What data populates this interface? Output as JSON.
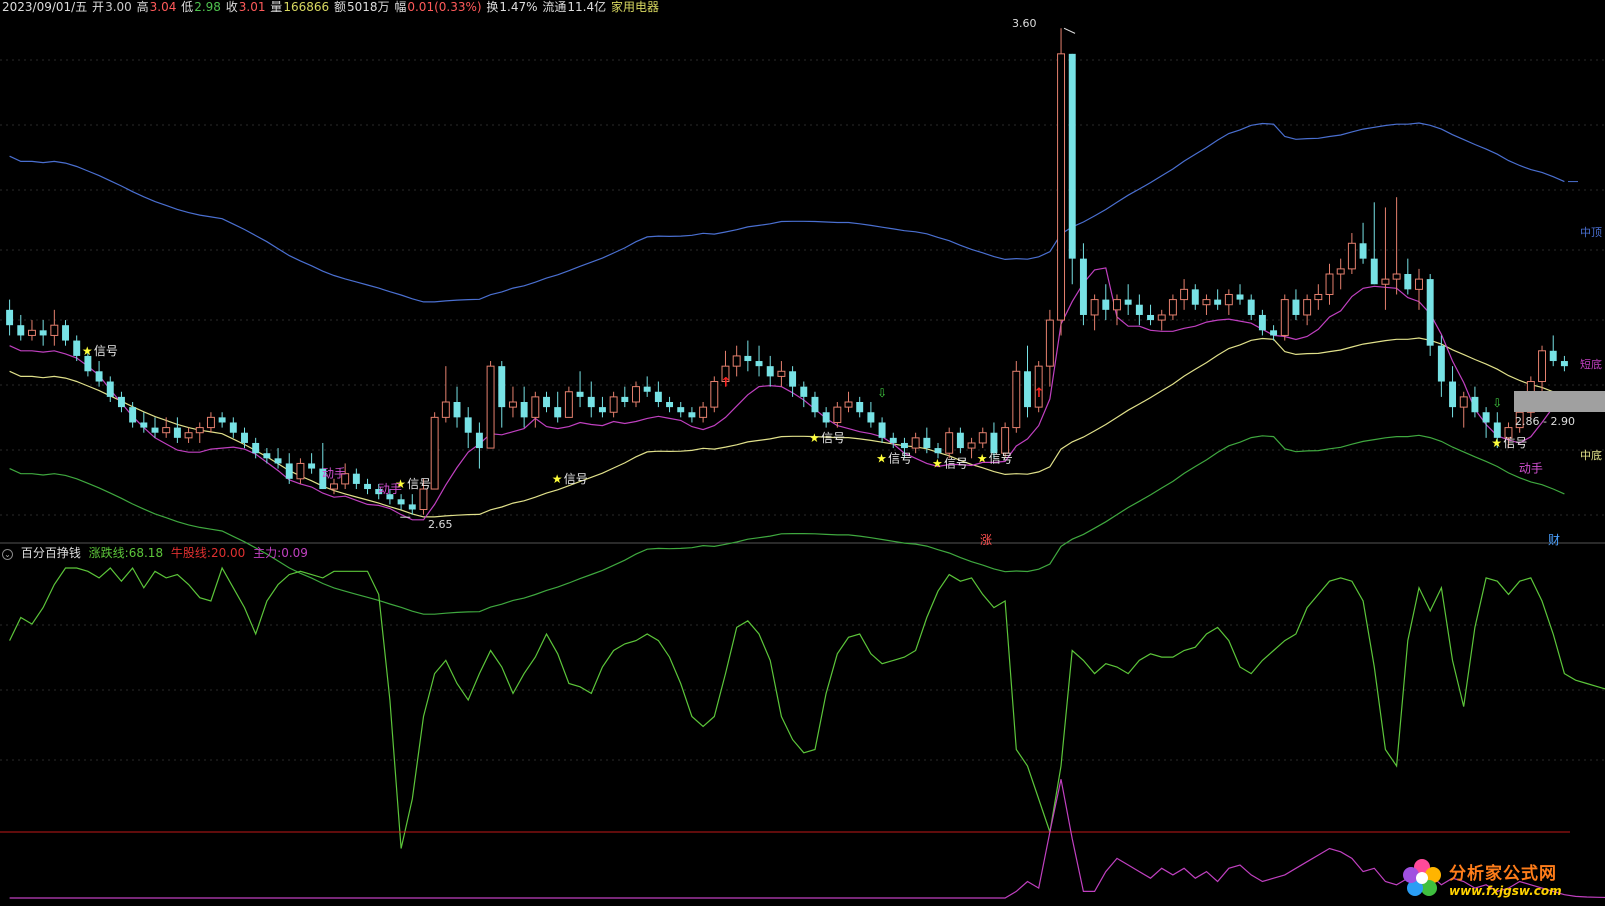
{
  "header": {
    "date": "2023/09/01/五",
    "open_label": "开",
    "open": "3.00",
    "high_label": "高",
    "high": "3.04",
    "low_label": "低",
    "low": "2.98",
    "close_label": "收",
    "close": "3.01",
    "vol_label": "量",
    "vol": "166866",
    "amt_label": "额",
    "amt": "5018万",
    "chg_label": "幅",
    "chg": "0.01(0.33%)",
    "turn_label": "换",
    "turn": "1.47%",
    "float_label": "流通",
    "float": "11.4亿",
    "sector": "家用电器"
  },
  "indicator": {
    "name": "百分百挣钱",
    "line1_label": "涨跌线:",
    "line1_value": "68.18",
    "line2_label": "牛股线:",
    "line2_value": "20.00",
    "line3_label": "主力:",
    "line3_value": "0.09"
  },
  "markers": {
    "max": "3.60",
    "min": "2.65",
    "band_top": "中顶",
    "band_short": "短底",
    "band_bottom": "中底",
    "range": "2.86 - 2.90",
    "zhang": "涨",
    "cai": "财"
  },
  "signal_text": "信号",
  "action_text": "动手",
  "colors": {
    "up": "#e5806e",
    "down": "#77e2e5",
    "upper_band": "#4a6fd0",
    "lower_band": "#e0e08a",
    "lower_green": "#3fa83f",
    "mid_magenta": "#c040c0",
    "osc_green": "#5cc53a",
    "osc_red": "#c01818",
    "osc_magenta": "#c040c0"
  },
  "watermark": {
    "cn": "分析家公式网",
    "url": "www.fxjgsw.com"
  },
  "chart_data": {
    "type": "candlestick",
    "price_extremes": {
      "high": 3.6,
      "low": 2.65
    },
    "candles": [
      [
        3.05,
        3.07,
        3.0,
        3.02
      ],
      [
        3.02,
        3.04,
        2.99,
        3.0
      ],
      [
        3.0,
        3.03,
        2.99,
        3.01
      ],
      [
        3.01,
        3.03,
        2.98,
        3.0
      ],
      [
        3.0,
        3.05,
        2.98,
        3.02
      ],
      [
        3.02,
        3.03,
        2.98,
        2.99
      ],
      [
        2.99,
        3.0,
        2.95,
        2.96
      ],
      [
        2.96,
        2.97,
        2.92,
        2.93
      ],
      [
        2.93,
        2.95,
        2.9,
        2.91
      ],
      [
        2.91,
        2.92,
        2.87,
        2.88
      ],
      [
        2.88,
        2.89,
        2.85,
        2.86
      ],
      [
        2.86,
        2.87,
        2.82,
        2.83
      ],
      [
        2.83,
        2.85,
        2.81,
        2.82
      ],
      [
        2.82,
        2.84,
        2.8,
        2.81
      ],
      [
        2.81,
        2.84,
        2.8,
        2.82
      ],
      [
        2.82,
        2.84,
        2.79,
        2.8
      ],
      [
        2.8,
        2.82,
        2.79,
        2.81
      ],
      [
        2.81,
        2.83,
        2.79,
        2.82
      ],
      [
        2.82,
        2.85,
        2.81,
        2.84
      ],
      [
        2.84,
        2.85,
        2.82,
        2.83
      ],
      [
        2.83,
        2.84,
        2.8,
        2.81
      ],
      [
        2.81,
        2.82,
        2.78,
        2.79
      ],
      [
        2.79,
        2.8,
        2.76,
        2.77
      ],
      [
        2.77,
        2.78,
        2.75,
        2.76
      ],
      [
        2.76,
        2.78,
        2.74,
        2.75
      ],
      [
        2.75,
        2.77,
        2.71,
        2.72
      ],
      [
        2.72,
        2.76,
        2.71,
        2.75
      ],
      [
        2.75,
        2.77,
        2.73,
        2.74
      ],
      [
        2.74,
        2.79,
        2.72,
        2.7
      ],
      [
        2.7,
        2.72,
        2.69,
        2.71
      ],
      [
        2.71,
        2.75,
        2.7,
        2.73
      ],
      [
        2.73,
        2.74,
        2.7,
        2.71
      ],
      [
        2.71,
        2.72,
        2.69,
        2.7
      ],
      [
        2.7,
        2.71,
        2.68,
        2.69
      ],
      [
        2.69,
        2.7,
        2.67,
        2.68
      ],
      [
        2.68,
        2.69,
        2.66,
        2.67
      ],
      [
        2.67,
        2.69,
        2.65,
        2.66
      ],
      [
        2.66,
        2.72,
        2.65,
        2.7
      ],
      [
        2.7,
        2.85,
        2.7,
        2.84
      ],
      [
        2.84,
        2.94,
        2.83,
        2.87
      ],
      [
        2.87,
        2.9,
        2.82,
        2.84
      ],
      [
        2.84,
        2.86,
        2.78,
        2.81
      ],
      [
        2.81,
        2.83,
        2.74,
        2.78
      ],
      [
        2.78,
        2.95,
        2.78,
        2.94
      ],
      [
        2.94,
        2.95,
        2.82,
        2.86
      ],
      [
        2.86,
        2.9,
        2.84,
        2.87
      ],
      [
        2.87,
        2.9,
        2.82,
        2.84
      ],
      [
        2.84,
        2.89,
        2.82,
        2.88
      ],
      [
        2.88,
        2.89,
        2.85,
        2.86
      ],
      [
        2.86,
        2.89,
        2.83,
        2.84
      ],
      [
        2.84,
        2.9,
        2.84,
        2.89
      ],
      [
        2.89,
        2.93,
        2.86,
        2.88
      ],
      [
        2.88,
        2.91,
        2.84,
        2.86
      ],
      [
        2.86,
        2.88,
        2.84,
        2.85
      ],
      [
        2.85,
        2.89,
        2.84,
        2.88
      ],
      [
        2.88,
        2.9,
        2.86,
        2.87
      ],
      [
        2.87,
        2.91,
        2.86,
        2.9
      ],
      [
        2.9,
        2.92,
        2.88,
        2.89
      ],
      [
        2.89,
        2.91,
        2.86,
        2.87
      ],
      [
        2.87,
        2.88,
        2.85,
        2.86
      ],
      [
        2.86,
        2.87,
        2.84,
        2.85
      ],
      [
        2.85,
        2.86,
        2.83,
        2.84
      ],
      [
        2.84,
        2.87,
        2.83,
        2.86
      ],
      [
        2.86,
        2.92,
        2.85,
        2.91
      ],
      [
        2.91,
        2.97,
        2.9,
        2.94
      ],
      [
        2.94,
        2.98,
        2.92,
        2.96
      ],
      [
        2.96,
        2.99,
        2.93,
        2.95
      ],
      [
        2.95,
        2.98,
        2.92,
        2.94
      ],
      [
        2.94,
        2.96,
        2.9,
        2.92
      ],
      [
        2.92,
        2.95,
        2.9,
        2.93
      ],
      [
        2.93,
        2.94,
        2.88,
        2.9
      ],
      [
        2.9,
        2.91,
        2.86,
        2.88
      ],
      [
        2.88,
        2.89,
        2.84,
        2.85
      ],
      [
        2.85,
        2.86,
        2.82,
        2.83
      ],
      [
        2.83,
        2.87,
        2.82,
        2.86
      ],
      [
        2.86,
        2.89,
        2.85,
        2.87
      ],
      [
        2.87,
        2.88,
        2.84,
        2.85
      ],
      [
        2.85,
        2.87,
        2.82,
        2.83
      ],
      [
        2.83,
        2.84,
        2.79,
        2.8
      ],
      [
        2.8,
        2.81,
        2.78,
        2.79
      ],
      [
        2.79,
        2.8,
        2.76,
        2.78
      ],
      [
        2.78,
        2.81,
        2.77,
        2.8
      ],
      [
        2.8,
        2.82,
        2.77,
        2.78
      ],
      [
        2.78,
        2.79,
        2.76,
        2.77
      ],
      [
        2.77,
        2.82,
        2.76,
        2.81
      ],
      [
        2.81,
        2.82,
        2.77,
        2.78
      ],
      [
        2.78,
        2.8,
        2.76,
        2.79
      ],
      [
        2.79,
        2.82,
        2.78,
        2.81
      ],
      [
        2.81,
        2.83,
        2.76,
        2.77
      ],
      [
        2.77,
        2.83,
        2.76,
        2.82
      ],
      [
        2.82,
        2.95,
        2.81,
        2.93
      ],
      [
        2.93,
        2.98,
        2.84,
        2.86
      ],
      [
        2.86,
        2.95,
        2.85,
        2.94
      ],
      [
        2.94,
        3.05,
        2.9,
        3.03
      ],
      [
        3.03,
        3.6,
        3.0,
        3.55
      ],
      [
        3.55,
        3.2,
        3.1,
        3.15
      ],
      [
        3.15,
        3.18,
        3.02,
        3.04
      ],
      [
        3.04,
        3.08,
        3.01,
        3.07
      ],
      [
        3.07,
        3.1,
        3.03,
        3.05
      ],
      [
        3.05,
        3.08,
        3.02,
        3.07
      ],
      [
        3.07,
        3.1,
        3.04,
        3.06
      ],
      [
        3.06,
        3.08,
        3.02,
        3.04
      ],
      [
        3.04,
        3.06,
        3.02,
        3.03
      ],
      [
        3.03,
        3.05,
        3.01,
        3.04
      ],
      [
        3.04,
        3.08,
        3.03,
        3.07
      ],
      [
        3.07,
        3.11,
        3.05,
        3.09
      ],
      [
        3.09,
        3.1,
        3.05,
        3.06
      ],
      [
        3.06,
        3.08,
        3.04,
        3.07
      ],
      [
        3.07,
        3.09,
        3.05,
        3.06
      ],
      [
        3.06,
        3.09,
        3.04,
        3.08
      ],
      [
        3.08,
        3.1,
        3.06,
        3.07
      ],
      [
        3.07,
        3.08,
        3.03,
        3.04
      ],
      [
        3.04,
        3.05,
        3.0,
        3.01
      ],
      [
        3.01,
        3.02,
        2.99,
        3.0
      ],
      [
        3.0,
        3.08,
        2.99,
        3.07
      ],
      [
        3.07,
        3.09,
        3.03,
        3.04
      ],
      [
        3.04,
        3.08,
        3.02,
        3.07
      ],
      [
        3.07,
        3.1,
        3.05,
        3.08
      ],
      [
        3.08,
        3.14,
        3.06,
        3.12
      ],
      [
        3.12,
        3.15,
        3.09,
        3.13
      ],
      [
        3.13,
        3.2,
        3.12,
        3.18
      ],
      [
        3.18,
        3.22,
        3.14,
        3.15
      ],
      [
        3.15,
        3.26,
        3.13,
        3.1
      ],
      [
        3.1,
        3.25,
        3.05,
        3.11
      ],
      [
        3.11,
        3.27,
        3.08,
        3.12
      ],
      [
        3.12,
        3.15,
        3.08,
        3.09
      ],
      [
        3.09,
        3.13,
        3.05,
        3.11
      ],
      [
        3.11,
        3.12,
        2.96,
        2.98
      ],
      [
        2.98,
        3.0,
        2.88,
        2.91
      ],
      [
        2.91,
        2.94,
        2.84,
        2.86
      ],
      [
        2.86,
        2.89,
        2.82,
        2.88
      ],
      [
        2.88,
        2.9,
        2.84,
        2.85
      ],
      [
        2.85,
        2.86,
        2.8,
        2.83
      ],
      [
        2.83,
        2.85,
        2.78,
        2.8
      ],
      [
        2.8,
        2.83,
        2.78,
        2.82
      ],
      [
        2.82,
        2.86,
        2.81,
        2.85
      ],
      [
        2.85,
        2.92,
        2.84,
        2.91
      ],
      [
        2.91,
        2.98,
        2.89,
        2.97
      ],
      [
        2.97,
        3.0,
        2.94,
        2.95
      ],
      [
        2.95,
        2.96,
        2.93,
        2.94
      ]
    ],
    "oscillator": {
      "series": [
        {
          "name": "涨跌线",
          "values": [
            78,
            85,
            83,
            88,
            95,
            100,
            100,
            99,
            97,
            100,
            96,
            100,
            94,
            99,
            97,
            98,
            95,
            91,
            90,
            100,
            94,
            88,
            80,
            90,
            95,
            98,
            99,
            98,
            97,
            99,
            99,
            99,
            99,
            92,
            60,
            15,
            30,
            55,
            68,
            72,
            65,
            60,
            68,
            75,
            70,
            62,
            68,
            73,
            80,
            74,
            65,
            64,
            62,
            70,
            75,
            77,
            78,
            80,
            78,
            73,
            65,
            55,
            52,
            55,
            68,
            82,
            84,
            80,
            72,
            55,
            48,
            44,
            45,
            62,
            74,
            79,
            80,
            74,
            71,
            72,
            73,
            75,
            85,
            93,
            98,
            96,
            97,
            92,
            88,
            90,
            45,
            40,
            30,
            20,
            40,
            75,
            72,
            68,
            71,
            70,
            68,
            72,
            74,
            73,
            73,
            75,
            76,
            80,
            82,
            78,
            70,
            68,
            72,
            75,
            78,
            80,
            88,
            92,
            96,
            97,
            96,
            90,
            70,
            45,
            40,
            78,
            94,
            87,
            94,
            72,
            58,
            82,
            97,
            96,
            92,
            96,
            97,
            90,
            80,
            68,
            66,
            65,
            64,
            63,
            62,
            62,
            63,
            64,
            66,
            68
          ]
        },
        {
          "name": "牛股线",
          "values": [
            20
          ]
        },
        {
          "name": "主力",
          "values": [
            0,
            0,
            0,
            0,
            0,
            0,
            0,
            0,
            0,
            0,
            0,
            0,
            0,
            0,
            0,
            0,
            0,
            0,
            0,
            0,
            0,
            0,
            0,
            0,
            0,
            0,
            0,
            0,
            0,
            0,
            0,
            0,
            0,
            0,
            0,
            0,
            0,
            0,
            0,
            0,
            0,
            0,
            0,
            0,
            0,
            0,
            0,
            0,
            0,
            0,
            0,
            0,
            0,
            0,
            0,
            0,
            0,
            0,
            0,
            0,
            0,
            0,
            0,
            0,
            0,
            0,
            0,
            0,
            0,
            0,
            0,
            0,
            0,
            0,
            0,
            0,
            0,
            0,
            0,
            0,
            0,
            0,
            0,
            0,
            0,
            0,
            0,
            0,
            0,
            0,
            2,
            5,
            3,
            20,
            36,
            18,
            2,
            2,
            8,
            12,
            10,
            8,
            6,
            9,
            7,
            9,
            6,
            8,
            5,
            9,
            10,
            7,
            5,
            6,
            7,
            9,
            11,
            13,
            15,
            14,
            12,
            8,
            9,
            5,
            4,
            6,
            3,
            7,
            4,
            6,
            5,
            3,
            4,
            2,
            3,
            5,
            4,
            3,
            2,
            1,
            0.5,
            0.3,
            0.2,
            0.15,
            0.12,
            0.1,
            0.1,
            0.09,
            0.09,
            0.09
          ]
        }
      ],
      "ylim": [
        0,
        100
      ]
    }
  }
}
